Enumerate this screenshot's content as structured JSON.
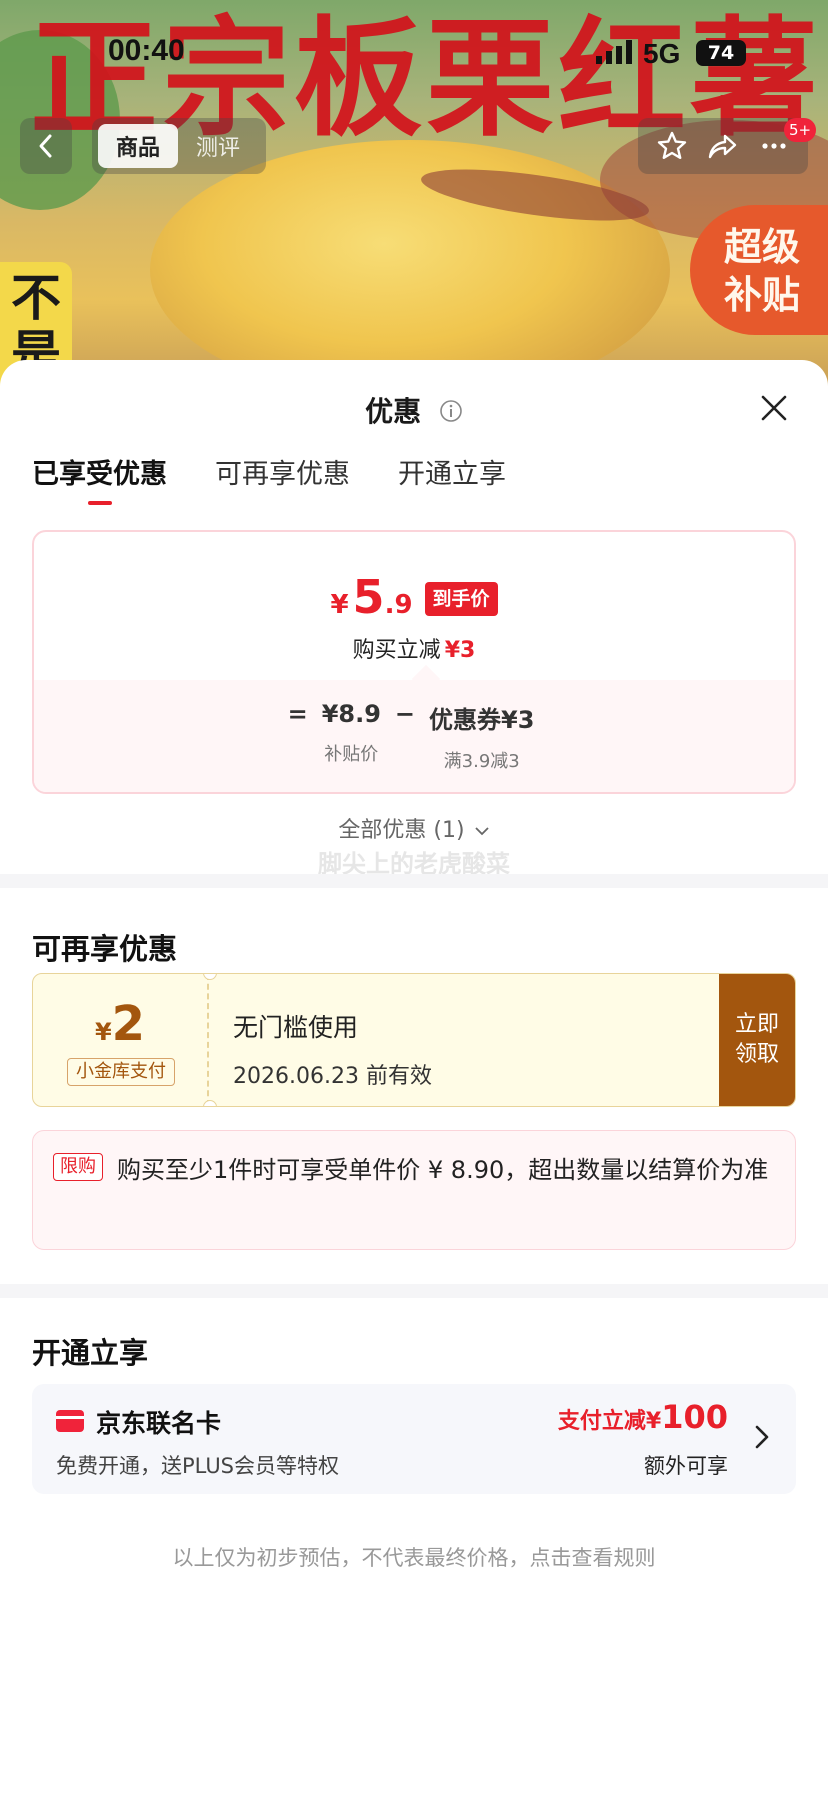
{
  "background": {
    "title_text": "正宗板栗红薯",
    "side_text": "不是",
    "badge_text": "超级补贴"
  },
  "status_bar": {
    "time": "00:40",
    "network": "5G",
    "battery": "74"
  },
  "top_nav": {
    "tabs": [
      {
        "label": "商品",
        "active": true
      },
      {
        "label": "测评",
        "active": false
      }
    ],
    "message_badge": "5+"
  },
  "sheet": {
    "title": "优惠",
    "tabs": [
      {
        "label": "已享受优惠",
        "active": true
      },
      {
        "label": "可再享优惠",
        "active": false
      },
      {
        "label": "开通立享",
        "active": false
      }
    ],
    "price_card": {
      "currency": "¥",
      "price_int": "5",
      "price_dec": ".9",
      "price_tag": "到手价",
      "reduce_label": "购买立减",
      "reduce_amount": "¥3",
      "formula": {
        "equals": "=",
        "base_value": "¥8.9",
        "base_label": "补贴价",
        "minus": "−",
        "coupon_value": "优惠券¥3",
        "coupon_label": "满3.9减3"
      }
    },
    "all_offers": "全部优惠 (1)",
    "watermark": "脚尖上的老虎酸菜",
    "more_section": {
      "title": "可再享优惠",
      "coupon": {
        "currency": "¥",
        "value": "2",
        "label": "小金库支付",
        "condition": "无门槛使用",
        "valid_until": "2026.06.23 前有效",
        "button": "立即领取"
      },
      "limit": {
        "tag": "限购",
        "text": "购买至少1件时可享受单件价 ¥ 8.90，超出数量以结算价为准"
      }
    },
    "open_section": {
      "title": "开通立享",
      "card": {
        "name": "京东联名卡",
        "desc": "免费开通，送PLUS会员等特权",
        "pay_prefix": "支付立减¥",
        "pay_amount": "100",
        "extra": "额外可享"
      }
    },
    "footnote": "以上仅为初步预估，不代表最终价格，点击查看规则"
  },
  "colors": {
    "accent": "#e8202b",
    "coupon_brown": "#a3560e",
    "coupon_bg": "#fffce6"
  }
}
